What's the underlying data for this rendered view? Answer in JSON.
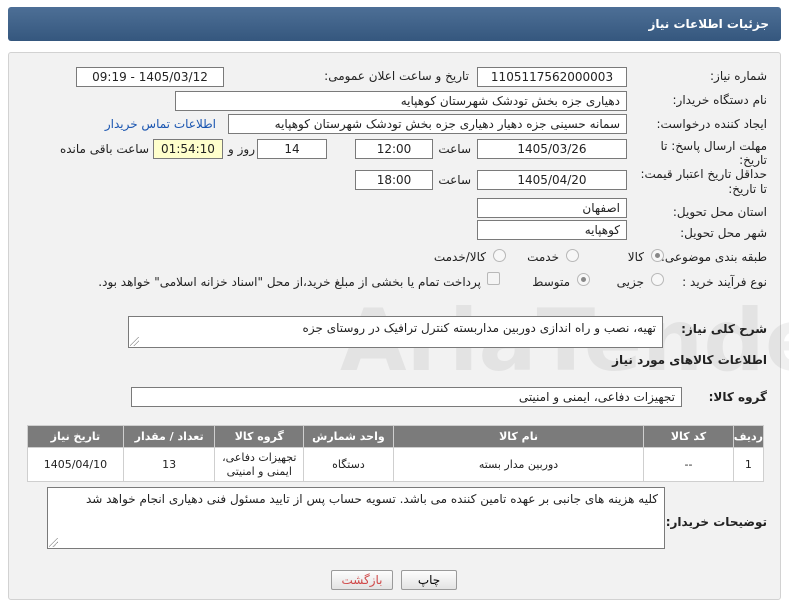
{
  "header": {
    "title": "جزئیات اطلاعات نیاز"
  },
  "form": {
    "need_number_label": "شماره نیاز:",
    "need_number": "1105117562000003",
    "announce_label": "تاریخ و ساعت اعلان عمومی:",
    "announce_value": "1405/03/12 - 09:19",
    "buyer_org_label": "نام دستگاه خریدار:",
    "buyer_org": "دهیاری جزه بخش تودشک شهرستان کوهپایه",
    "creator_label": "ایجاد کننده درخواست:",
    "creator": "سمانه حسینی جزه دهیار دهیاری جزه بخش تودشک شهرستان کوهپایه",
    "contact_link": "اطلاعات تماس خریدار",
    "deadline_label_1": "مهلت ارسال پاسخ: تا",
    "deadline_label_2": "تاریخ:",
    "deadline_date": "1405/03/26",
    "time_label": "ساعت",
    "deadline_time": "12:00",
    "days_value": "14",
    "days_label": "روز و",
    "remaining_time": "01:54:10",
    "remaining_label": "ساعت باقی مانده",
    "validity_label_1": "حداقل تاریخ اعتبار قیمت:",
    "validity_label_2": "تا تاریخ:",
    "validity_date": "1405/04/20",
    "validity_time_label": "ساعت",
    "validity_time": "18:00",
    "province_label": "استان محل تحویل:",
    "province": "اصفهان",
    "city_label": "شهر محل تحویل:",
    "city": "کوهپایه",
    "category_label": "طبقه بندی موضوعی:",
    "category_options": [
      "کالا",
      "خدمت",
      "کالا/خدمت"
    ],
    "category_selected": "کالا",
    "purchase_type_label": "نوع فرآیند خرید :",
    "purchase_options": [
      "جزیی",
      "متوسط"
    ],
    "purchase_selected": "متوسط",
    "treasury_note": "پرداخت تمام یا بخشی از مبلغ خرید،از محل \"اسناد خزانه اسلامی\" خواهد بود.",
    "general_desc_label": "شرح کلی نیاز:",
    "general_desc": "تهیه، نصب و راه اندازی دوربین مداربسته کنترل ترافیک در روستای جزه"
  },
  "goods": {
    "section_title": "اطلاعات کالاهای مورد نیاز",
    "group_label": "گروه کالا:",
    "group_value": "تجهیزات دفاعی، ایمنی و امنیتی",
    "columns": [
      "ردیف",
      "کد کالا",
      "نام کالا",
      "واحد شمارش",
      "گروه کالا",
      "تعداد / مقدار",
      "تاریخ نیاز"
    ],
    "rows": [
      {
        "row": "1",
        "code": "--",
        "name": "دوربین مدار بسته",
        "unit": "دستگاه",
        "group_line1": "تجهیزات دفاعی،",
        "group_line2": "ایمنی و امنیتی",
        "quantity": "13",
        "need_date": "1405/04/10"
      }
    ]
  },
  "buyer_notes": {
    "label": "توضیحات خریدار:",
    "text": "کلیه هزینه های جانبی بر عهده تامین کننده می باشد. تسویه حساب پس از تایید مسئول فنی دهیاری انجام خواهد شد"
  },
  "buttons": {
    "print": "چاپ",
    "back": "بازگشت"
  },
  "watermark": {
    "text": "AriaTender.net"
  },
  "colors": {
    "header_bg": "#3f628a",
    "link": "#1a55b0",
    "table_header": "#7b7b7b",
    "back_text": "#d04a4a"
  }
}
